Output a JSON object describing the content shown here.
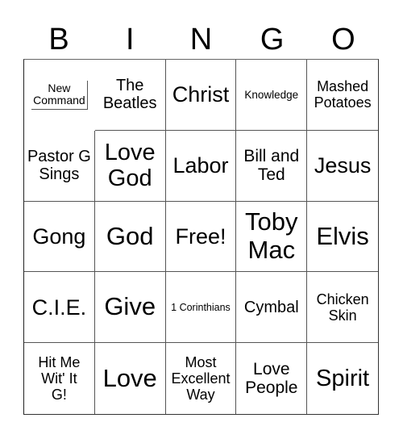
{
  "header": {
    "letters": [
      "B",
      "I",
      "N",
      "G",
      "O"
    ]
  },
  "cells": [
    "New Command",
    "The Beatles",
    "Christ",
    "Knowledge",
    "Mashed Potatoes",
    "Pastor G Sings",
    "Love God",
    "Labor",
    "Bill and Ted",
    "Jesus",
    "Gong",
    "God",
    "Free!",
    "Toby Mac",
    "Elvis",
    "C.I.E.",
    "Give",
    "1 Corinthians",
    "Cymbal",
    "Chicken Skin",
    "Hit Me Wit' It G!",
    "Love",
    "Most Excellent Way",
    "Love People",
    "Spirit"
  ]
}
